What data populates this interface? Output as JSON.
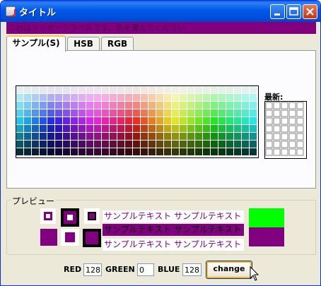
{
  "window": {
    "title": "タイトル",
    "message": "これはメッセージラベルです。色を選んでください"
  },
  "tabs": [
    {
      "label": "サンプル(S)",
      "active": true
    },
    {
      "label": "HSB",
      "active": false
    },
    {
      "label": "RGB",
      "active": false
    }
  ],
  "swatches": {
    "recent_label": "最新:"
  },
  "preview": {
    "title": "プレビュー",
    "sample_text_1": "サンプルテキスト サンプルテキスト",
    "sample_text_2": "サンプルテキスト サンプルテキスト",
    "sample_text_3": "サンプルテキスト サンプルテキスト",
    "colors": {
      "selected": "#800080",
      "green": "#00ff00"
    }
  },
  "controls": {
    "red_label": "RED",
    "red_value": "128",
    "green_label": "GREEN",
    "green_value": "0",
    "blue_label": "BLUE",
    "blue_value": "128",
    "change_label": "change"
  }
}
